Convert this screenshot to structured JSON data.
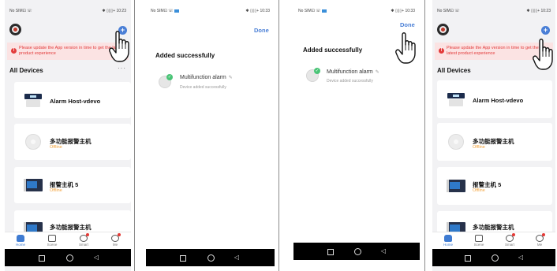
{
  "status": {
    "left": "No SIM⊡ ☏",
    "right_a": "✱ ▯▯▯+ 10:23",
    "right_b": "✱ ▯▯▯+ 10:33"
  },
  "home": {
    "banner": "Please update the App version in time to get the latest product experience",
    "section_title": "All Devices",
    "more": "···",
    "devices": [
      {
        "name": "Alarm Host-vdevo",
        "status": ""
      },
      {
        "name": "多功能报警主机",
        "status": "Offline"
      },
      {
        "name": "报警主机 5",
        "status": "Offline"
      },
      {
        "name": "多功能报警主机",
        "status": ""
      }
    ],
    "tabs": [
      {
        "label": "Home"
      },
      {
        "label": "Scene"
      },
      {
        "label": "Smart"
      },
      {
        "label": "Me"
      }
    ]
  },
  "added": {
    "done": "Done",
    "title": "Added successfully",
    "device_name": "Multifunction alarm",
    "pencil": "✎",
    "device_sub": "Device added successfully"
  },
  "nav": {
    "back": "◁"
  },
  "colors": {
    "accent": "#4a7fd6",
    "offline": "#f2a23a",
    "warning": "#e23a3a",
    "success": "#49c476"
  }
}
